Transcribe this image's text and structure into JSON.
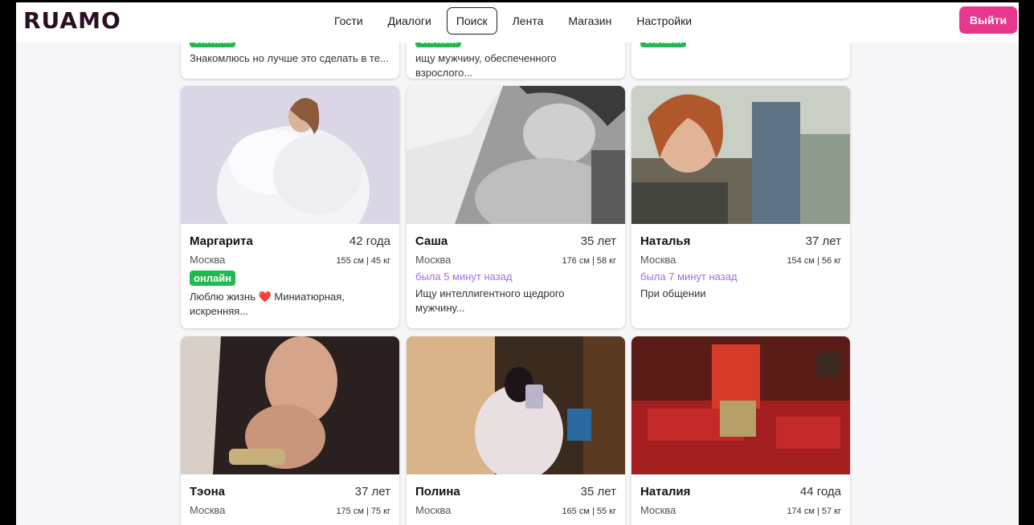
{
  "header": {
    "logo": "RUAMO",
    "nav": [
      "Гости",
      "Диалоги",
      "Поиск",
      "Лента",
      "Магазин",
      "Настройки"
    ],
    "active_nav": "Поиск",
    "logout": "Выйти"
  },
  "top_cards": [
    {
      "badge": "онлайн",
      "about": "Знакомлюсь но лучше это сделать в те..."
    },
    {
      "badge": "онлайн",
      "about": "ищу мужчину, обеспеченного взрослого..."
    },
    {
      "badge": "онлайн",
      "about": ""
    }
  ],
  "cards": [
    {
      "name": "Маргарита",
      "age": "42 года",
      "city": "Москва",
      "hw": "155 см | 45 кг",
      "status": "онлайн",
      "status_type": "online",
      "about": "Люблю жизнь",
      "about_heart": "❤️",
      "about2": "Миниатюрная, искренняя..."
    },
    {
      "name": "Саша",
      "age": "35 лет",
      "city": "Москва",
      "hw": "176 см | 58 кг",
      "status": "была 5 минут назад",
      "status_type": "seen",
      "about": "Ищу интеллигентного щедрого мужчину...",
      "about_heart": "",
      "about2": ""
    },
    {
      "name": "Наталья",
      "age": "37 лет",
      "city": "Москва",
      "hw": "154 см | 56 кг",
      "status": "была 7 минут назад",
      "status_type": "seen",
      "about": "При общении",
      "about_heart": "",
      "about2": ""
    },
    {
      "name": "Тэона",
      "age": "37 лет",
      "city": "Москва",
      "hw": "175 см | 75 кг"
    },
    {
      "name": "Полина",
      "age": "35 лет",
      "city": "Москва",
      "hw": "165 см | 55 кг"
    },
    {
      "name": "Наталия",
      "age": "44 года",
      "city": "Москва",
      "hw": "174 см | 57 кг"
    }
  ],
  "colors": {
    "accent": "#e6398d",
    "online": "#1fba4f",
    "seen": "#a46de0",
    "logo": "#2b0f22"
  }
}
